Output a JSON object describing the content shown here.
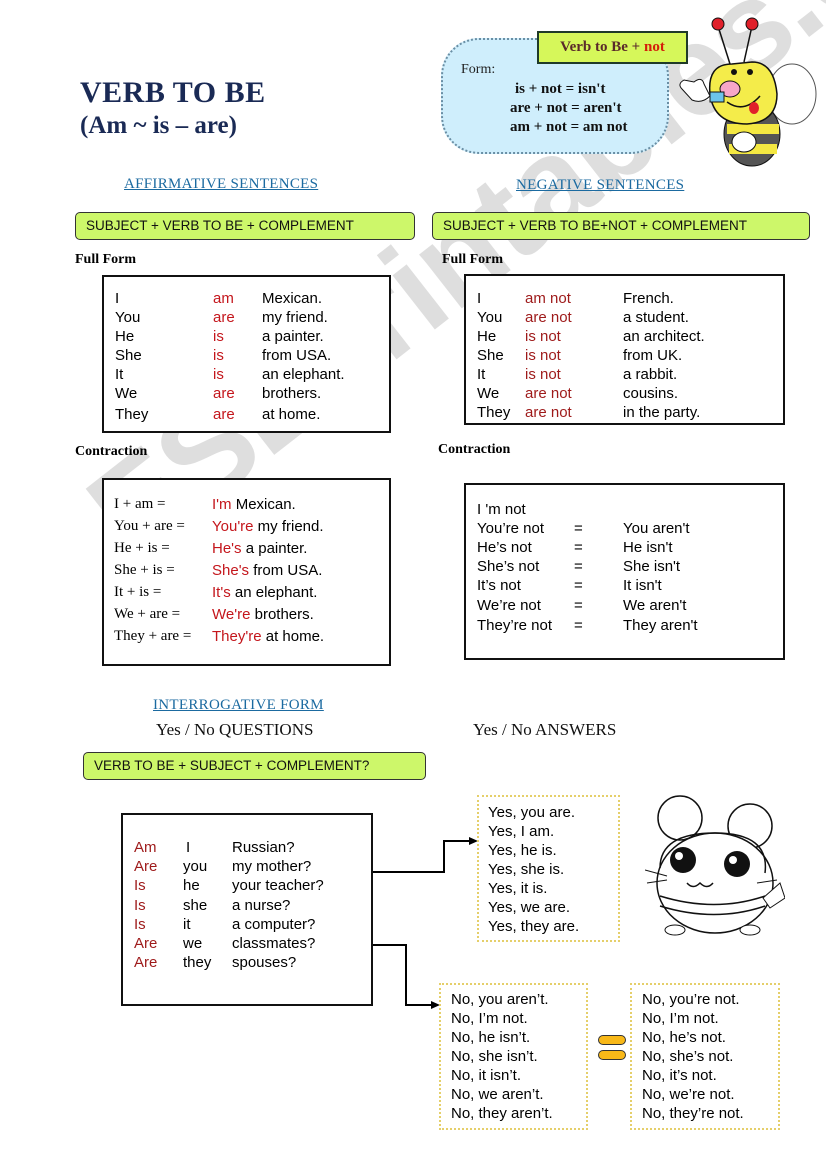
{
  "header": {
    "title_line1": "VERB TO BE",
    "title_line2": "(Am ~ is – are)"
  },
  "negation_note": {
    "box_prefix": "Verb to Be + ",
    "box_not": "not",
    "form_label": "Form:",
    "rules": [
      "is + not = isn't",
      "are + not = aren't",
      "am + not = am not"
    ]
  },
  "affirmative": {
    "heading": "AFFIRMATIVE SENTENCES",
    "formula": "SUBJECT  +  VERB TO BE  +  COMPLEMENT",
    "full_form_label": "Full Form",
    "full_form_rows": [
      {
        "subject": "I",
        "verb": "am",
        "complement": "Mexican."
      },
      {
        "subject": "You",
        "verb": "are",
        "complement": "my friend."
      },
      {
        "subject": "He",
        "verb": "is",
        "complement": "a painter."
      },
      {
        "subject": "She",
        "verb": "is",
        "complement": "from USA."
      },
      {
        "subject": "It",
        "verb": "is",
        "complement": "an elephant."
      },
      {
        "subject": "We",
        "verb": "are",
        "complement": "brothers."
      },
      {
        "subject": "They",
        "verb": "are",
        "complement": "at home."
      }
    ],
    "contraction_label": "Contraction",
    "contraction_rows": [
      {
        "formula": "I + am =",
        "contraction": "I'm",
        "complement": " Mexican."
      },
      {
        "formula": "You + are =",
        "contraction": "You're",
        "complement": " my friend."
      },
      {
        "formula": "He + is =",
        "contraction": "He's",
        "complement": " a painter."
      },
      {
        "formula": "She + is =",
        "contraction": "She's",
        "complement": " from USA."
      },
      {
        "formula": "It + is =",
        "contraction": "It's",
        "complement": " an elephant."
      },
      {
        "formula": "We + are =",
        "contraction": "We're",
        "complement": " brothers."
      },
      {
        "formula": "They + are =",
        "contraction": "They're",
        "complement": " at home."
      }
    ]
  },
  "negative": {
    "heading": "NEGATIVE SENTENCES",
    "formula": "SUBJECT  +  VERB TO BE+NOT  +  COMPLEMENT",
    "full_form_label": "Full Form",
    "full_form_rows": [
      {
        "subject": "I",
        "verb": "am not",
        "complement": "French."
      },
      {
        "subject": "You",
        "verb": "are not",
        "complement": "a student."
      },
      {
        "subject": "He",
        "verb": "is not",
        "complement": "an architect."
      },
      {
        "subject": "She",
        "verb": "is not",
        "complement": "from UK."
      },
      {
        "subject": "It",
        "verb": "is not",
        "complement": "a rabbit."
      },
      {
        "subject": "We",
        "verb": "are not",
        "complement": "cousins."
      },
      {
        "subject": "They",
        "verb": "are not",
        "complement": "in the party."
      }
    ],
    "contraction_label": "Contraction",
    "contraction_first": "I 'm not",
    "contraction_rows": [
      {
        "left": "You’re not",
        "eq": "=",
        "right": "You aren't"
      },
      {
        "left": "He’s not",
        "eq": "=",
        "right": "He isn't"
      },
      {
        "left": "She’s not",
        "eq": "=",
        "right": "She isn't"
      },
      {
        "left": "It’s not",
        "eq": "=",
        "right": "It isn't"
      },
      {
        "left": "We’re not",
        "eq": "=",
        "right": "We aren't"
      },
      {
        "left": "They’re not",
        "eq": "=",
        "right": "They aren't"
      }
    ]
  },
  "interrogative": {
    "heading": "INTERROGATIVE FORM",
    "questions_title": "Yes / No QUESTIONS",
    "answers_title": "Yes / No ANSWERS",
    "formula": "VERB TO BE  +  SUBJECT  +  COMPLEMENT?",
    "question_rows": [
      {
        "verb": "Am",
        "subject": "I",
        "complement": "Russian?"
      },
      {
        "verb": "Are",
        "subject": "you",
        "complement": "my mother?"
      },
      {
        "verb": "Is",
        "subject": "he",
        "complement": "your teacher?"
      },
      {
        "verb": "Is",
        "subject": "she",
        "complement": "a nurse?"
      },
      {
        "verb": "Is",
        "subject": "it",
        "complement": "a computer?"
      },
      {
        "verb": "Are",
        "subject": "we",
        "complement": "classmates?"
      },
      {
        "verb": "Are",
        "subject": "they",
        "complement": "spouses?"
      }
    ],
    "yes_answers": [
      "Yes, you are.",
      "Yes, I am.",
      "Yes, he is.",
      "Yes, she is.",
      "Yes, it is.",
      "Yes, we are.",
      "Yes, they are."
    ],
    "no_answers_short": [
      "No, you aren’t.",
      "No, I’m not.",
      "No, he isn’t.",
      "No, she isn’t.",
      "No, it isn’t.",
      "No, we aren’t.",
      "No, they aren’t."
    ],
    "no_answers_alt": [
      "No, you’re not.",
      "No, I’m not.",
      "No, he’s not.",
      "No, she’s not.",
      "No, it’s not.",
      "No, we’re not.",
      "No, they’re not."
    ]
  },
  "watermark": "ESLprintables.com",
  "colors": {
    "title": "#1a2a55",
    "section_heading": "#1b6aa0",
    "formula_bg": "#cdf76a",
    "verb_red": "#c4161c",
    "bubble_bg": "#cfeefc",
    "equals_yellow": "#f8b818"
  }
}
